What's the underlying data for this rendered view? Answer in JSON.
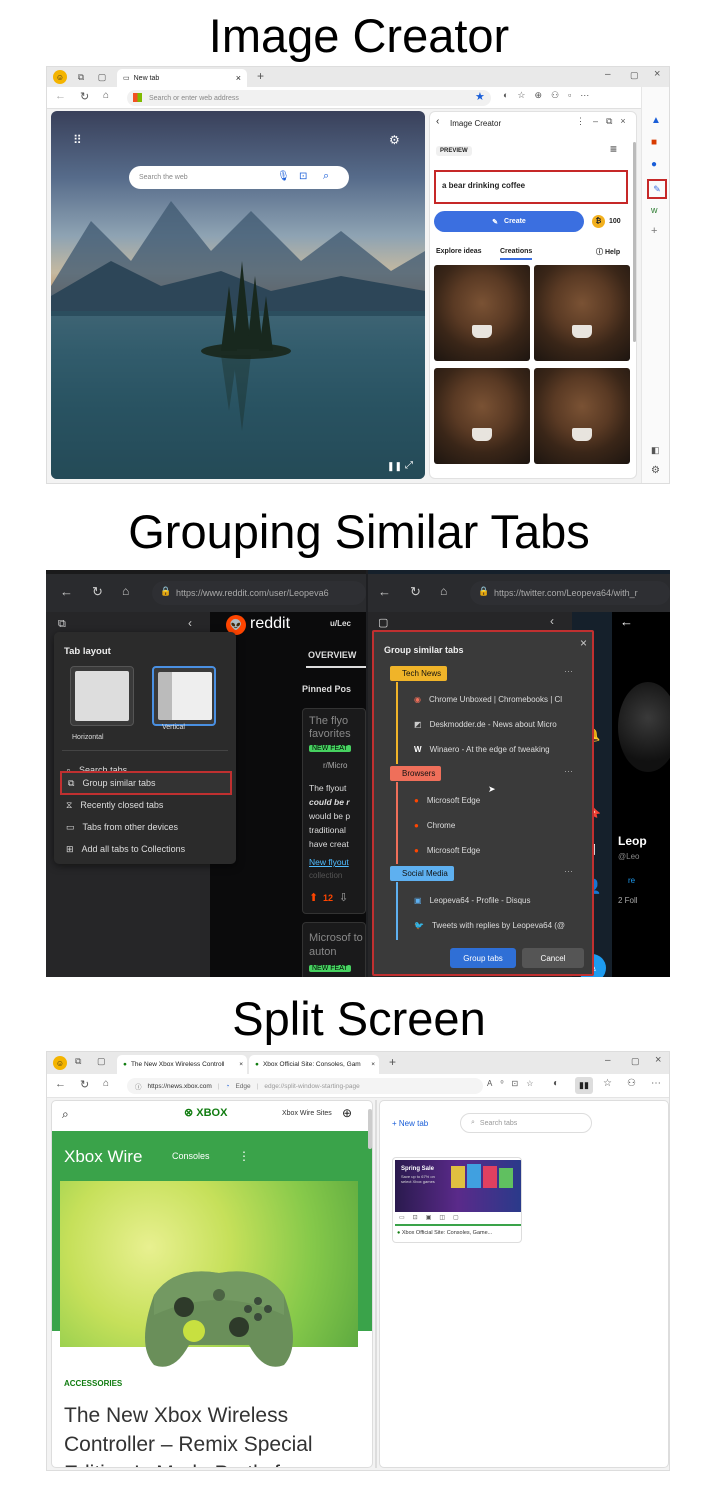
{
  "headings": {
    "image_creator": "Image Creator",
    "grouping": "Grouping Similar Tabs",
    "split": "Split Screen"
  },
  "p1": {
    "tab_title": "New tab",
    "address_placeholder": "Search or enter web address",
    "search_placeholder": "Search the web",
    "sidebar_title": "Image Creator",
    "preview_label": "PREVIEW",
    "prompt": "a bear drinking coffee",
    "create_label": "Create",
    "boosts": "100",
    "explore_tab": "Explore ideas",
    "creations_tab": "Creations",
    "help": "Help",
    "accent": "#3b6fe0"
  },
  "p2": {
    "left_url": "https://www.reddit.com/user/Leopeva6",
    "right_url": "https://twitter.com/Leopeva64/with_r",
    "reddit_brand": "reddit",
    "reddit_user": "u/Lec",
    "overview": "OVERVIEW",
    "pinned": "Pinned Pos",
    "post_title": "The flyo favorites",
    "new_feat": "NEW FEAT",
    "sub": "r/Micro",
    "body_lines": [
      "The flyout",
      "could be r",
      "would be p",
      "traditional",
      "have creat"
    ],
    "link": "New flyout",
    "faded": "collection",
    "votes": "12",
    "post2_title": "Microsof to auton",
    "new_feat2": "NEW FEAT",
    "menu": {
      "title": "Tab layout",
      "horizontal": "Horizontal",
      "vertical": "Vertical",
      "items": [
        "Search tabs",
        "Group similar tabs",
        "Recently closed tabs",
        "Tabs from other devices",
        "Add all tabs to Collections"
      ]
    },
    "group": {
      "title": "Group similar tabs",
      "groups": [
        {
          "name": "Tech News",
          "color": "#f0b429",
          "tabs": [
            "Chrome Unboxed | Chromebooks | Cl",
            "Deskmodder.de - News about Micro",
            "Winaero - At the edge of tweaking"
          ]
        },
        {
          "name": "Browsers",
          "color": "#ef6f5a",
          "tabs": [
            "Microsoft Edge",
            "Chrome",
            "Microsoft Edge"
          ]
        },
        {
          "name": "Social Media",
          "color": "#5eb0f0",
          "tabs": [
            "Leopeva64 - Profile - Disqus",
            "Tweets with replies by Leopeva64 (@"
          ]
        }
      ],
      "group_button": "Group tabs",
      "cancel_button": "Cancel"
    },
    "profile_name": "Leop",
    "profile_handle": "@Leo",
    "following": "2 Foll",
    "re": "re"
  },
  "p3": {
    "tab1": "The New Xbox Wireless Controll",
    "tab2": "Xbox Official Site: Consoles, Gam",
    "url_left": "https://news.xbox.com",
    "edge_label": "Edge",
    "url_right": "edge://split-window-starting-page",
    "xbox_logo": "XBOX",
    "xbox_wire_sites": "Xbox Wire Sites",
    "xbox_wire": "Xbox Wire",
    "consoles": "Consoles",
    "category": "ACCESSORIES",
    "article_title": "The New Xbox Wireless Controller – Remix Special Edition Is Made Partly from",
    "new_tab": "New tab",
    "search_tabs": "Search tabs",
    "thumb_caption": "Xbox Official Site: Consoles, Game...",
    "thumb_promo": "Spring Sale",
    "thumb_sub": "Save up to 67% on select Xbox games"
  }
}
